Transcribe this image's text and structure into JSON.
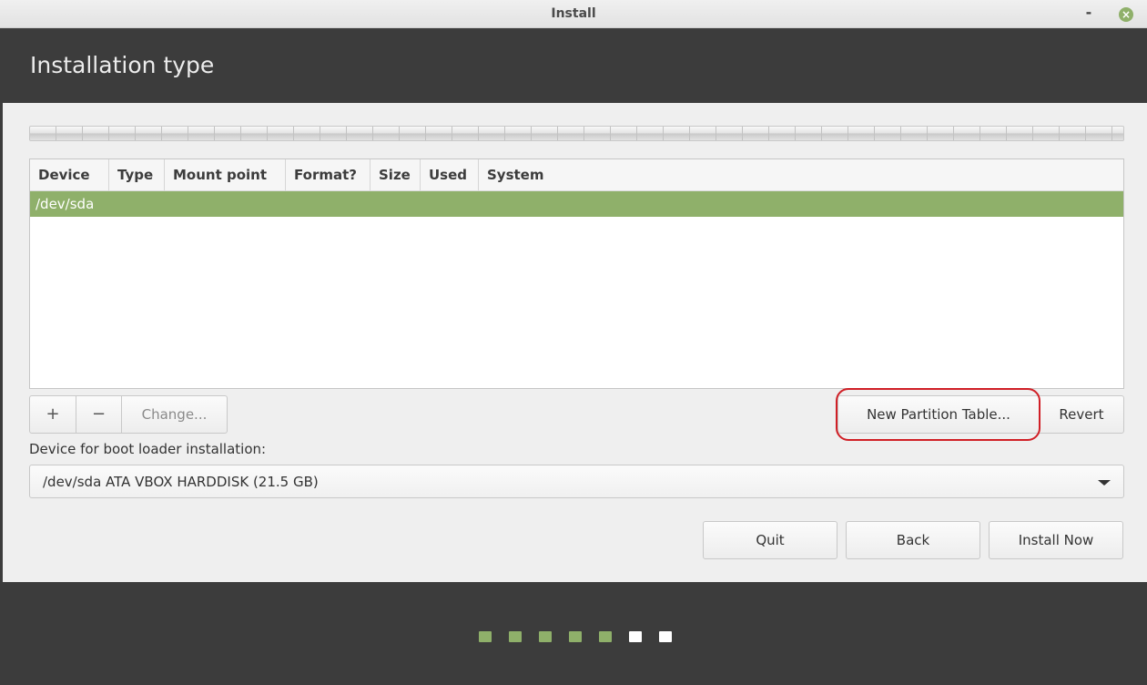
{
  "window": {
    "title": "Install",
    "minimize_symbol": "-",
    "close_symbol": "×"
  },
  "header": {
    "title": "Installation type"
  },
  "table": {
    "columns": [
      "Device",
      "Type",
      "Mount point",
      "Format?",
      "Size",
      "Used",
      "System"
    ],
    "rows": [
      {
        "device": "/dev/sda",
        "selected": true
      }
    ]
  },
  "partition_buttons": {
    "add": "+",
    "remove": "−",
    "change": "Change..."
  },
  "actions": {
    "new_partition_table": "New Partition Table...",
    "revert": "Revert"
  },
  "bootloader": {
    "label": "Device for boot loader installation:",
    "value": "/dev/sda ATA VBOX HARDDISK (21.5 GB)"
  },
  "nav": {
    "quit": "Quit",
    "back": "Back",
    "install_now": "Install Now"
  },
  "progress": {
    "completed_steps": 5,
    "total_steps": 7
  },
  "colors": {
    "accent": "#8fb06a",
    "header_bg": "#3c3c3c",
    "highlight": "#d01f26"
  }
}
